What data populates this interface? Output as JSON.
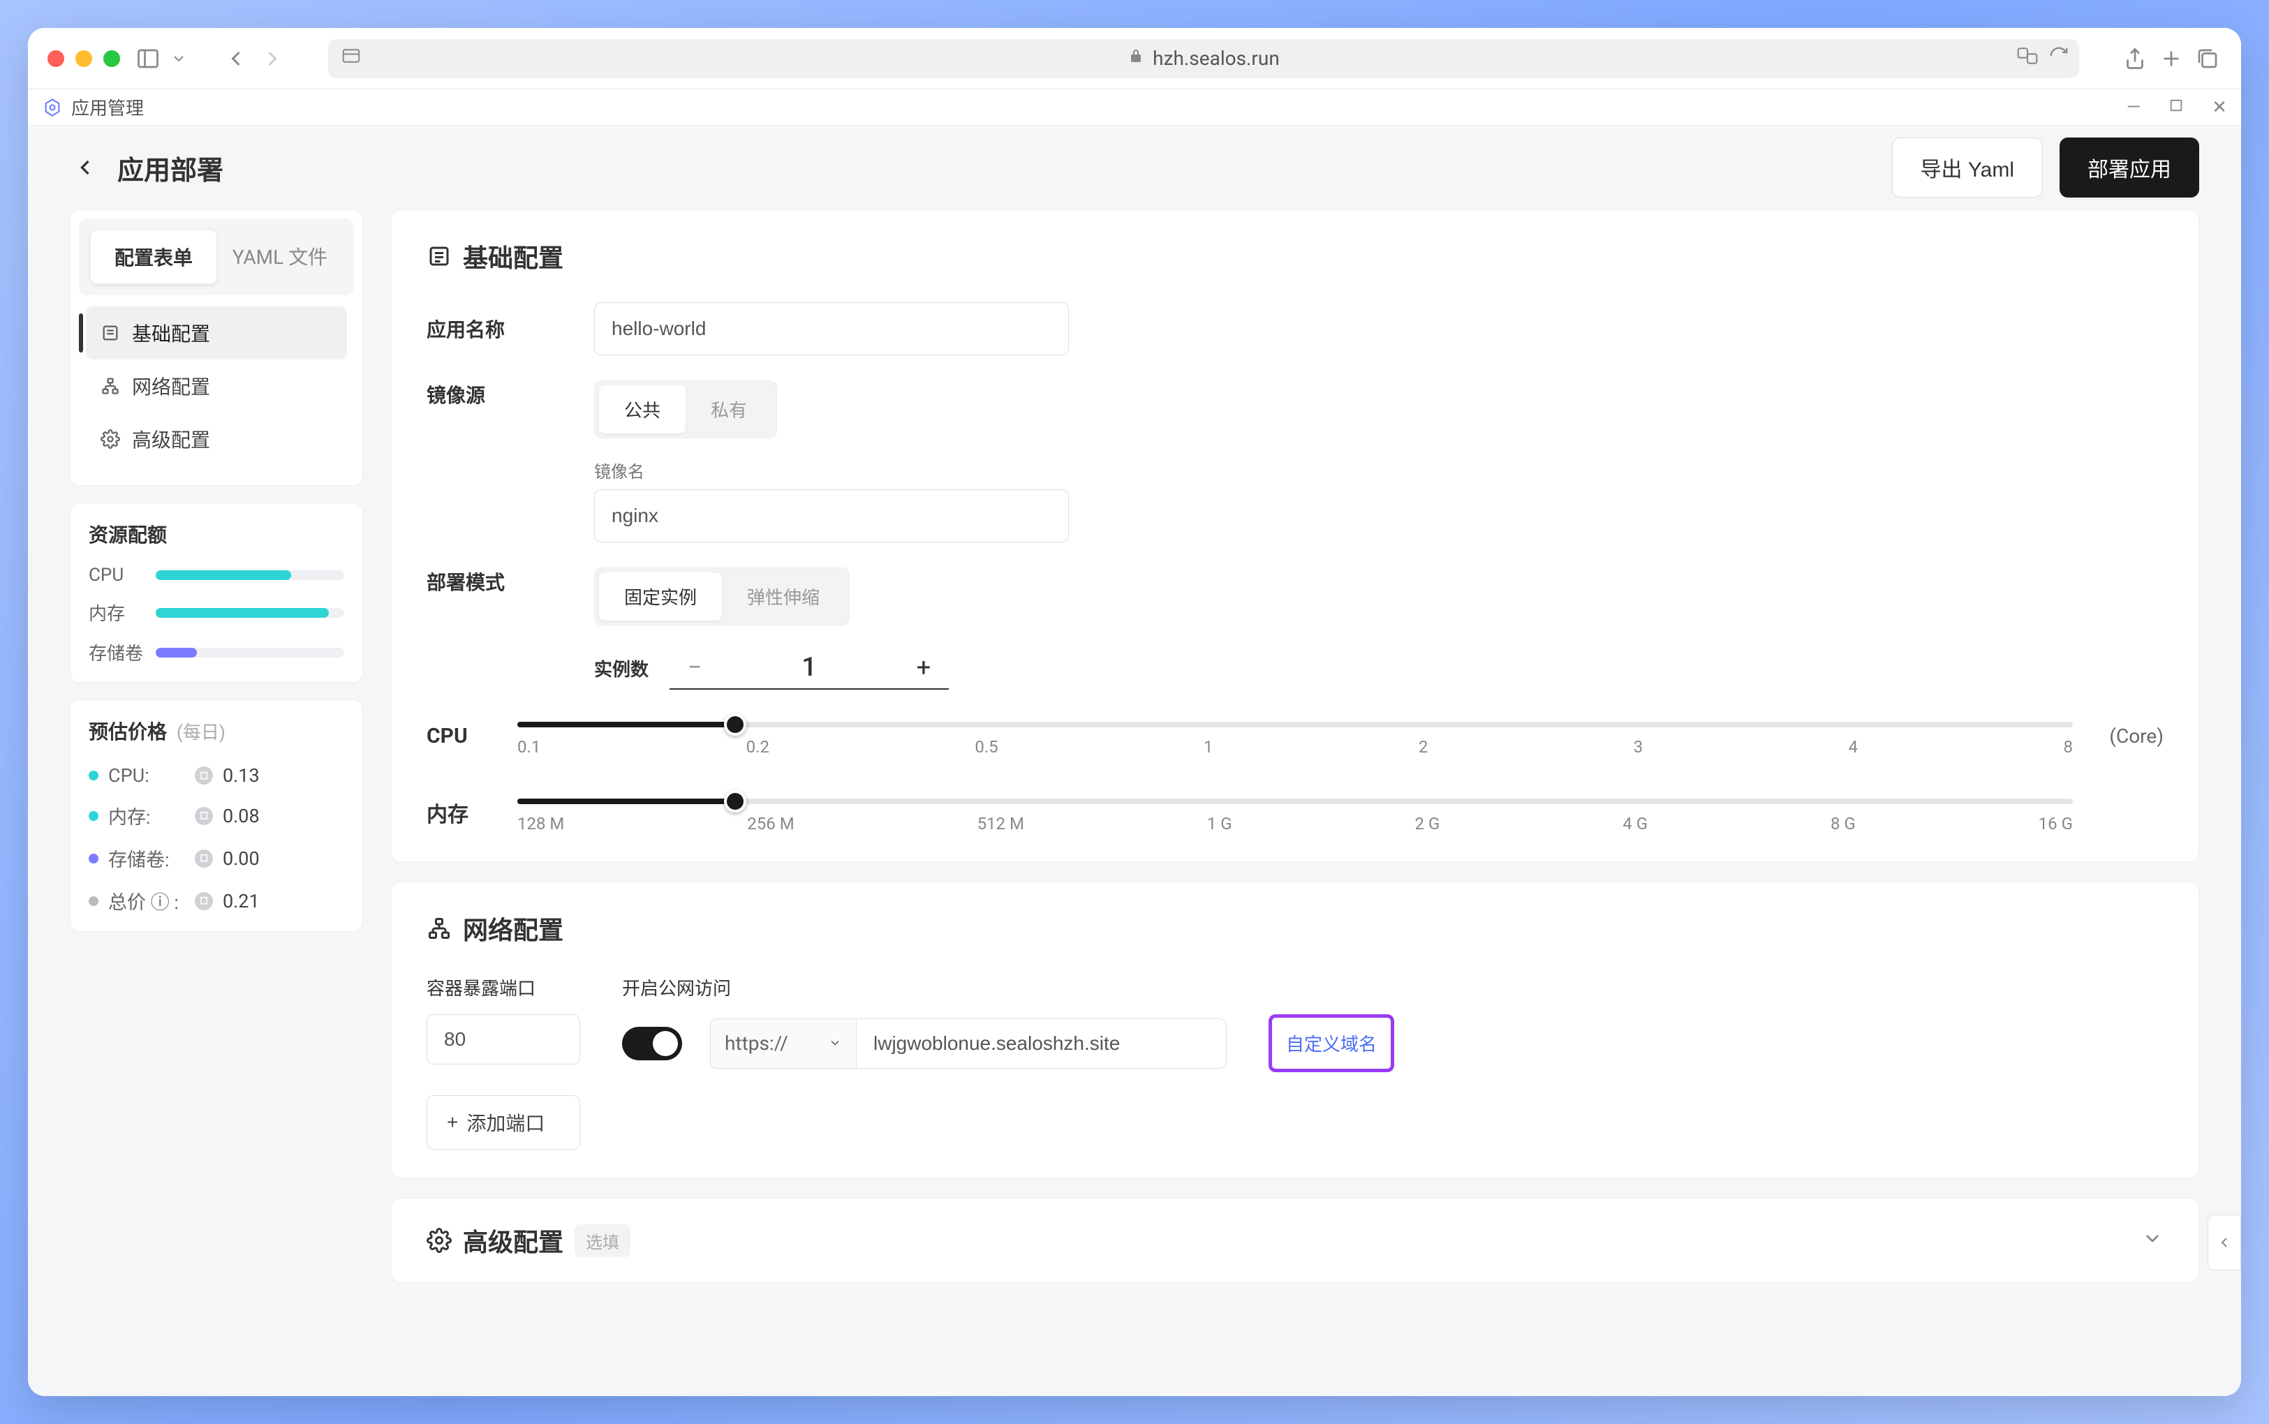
{
  "browser": {
    "url": "hzh.sealos.run"
  },
  "tab": {
    "title": "应用管理"
  },
  "header": {
    "title": "应用部署",
    "export_yaml": "导出 Yaml",
    "deploy": "部署应用"
  },
  "sidebar": {
    "tabs": {
      "config": "配置表单",
      "yaml": "YAML 文件"
    },
    "nav": {
      "basic": "基础配置",
      "network": "网络配置",
      "advanced": "高级配置"
    },
    "quota": {
      "title": "资源配额",
      "cpu": {
        "label": "CPU",
        "percent": 72
      },
      "mem": {
        "label": "内存",
        "percent": 92
      },
      "storage": {
        "label": "存储卷",
        "percent": 22
      }
    },
    "pricing": {
      "title": "预估价格",
      "period": "(每日)",
      "items": {
        "cpu": {
          "label": "CPU:",
          "value": "0.13"
        },
        "mem": {
          "label": "内存:",
          "value": "0.08"
        },
        "storage": {
          "label": "存储卷:",
          "value": "0.00"
        },
        "total": {
          "label": "总价 ⓘ :",
          "value": "0.21"
        }
      }
    }
  },
  "basic": {
    "title": "基础配置",
    "app_name": {
      "label": "应用名称",
      "value": "hello-world"
    },
    "image_source": {
      "label": "镜像源",
      "opts": {
        "public": "公共",
        "private": "私有"
      }
    },
    "image_name": {
      "label": "镜像名",
      "value": "nginx"
    },
    "deploy_mode": {
      "label": "部署模式",
      "opts": {
        "fixed": "固定实例",
        "elastic": "弹性伸缩"
      }
    },
    "instances": {
      "label": "实例数",
      "value": "1"
    },
    "cpu_slider": {
      "label": "CPU",
      "unit": "(Core)",
      "ticks": [
        "0.1",
        "0.2",
        "0.5",
        "1",
        "2",
        "3",
        "4",
        "8"
      ],
      "fill_percent": 14,
      "thumb_percent": 14
    },
    "mem_slider": {
      "label": "内存",
      "ticks": [
        "128 M",
        "256 M",
        "512 M",
        "1 G",
        "2 G",
        "4 G",
        "8 G",
        "16 G"
      ],
      "fill_percent": 14,
      "thumb_percent": 14
    }
  },
  "network": {
    "title": "网络配置",
    "port_label": "容器暴露端口",
    "port_value": "80",
    "public_label": "开启公网访问",
    "protocol": "https://",
    "domain": "lwjgwoblonue.sealoshzh.site",
    "custom_domain": "自定义域名",
    "add_port": "添加端口"
  },
  "advanced": {
    "title": "高级配置",
    "badge": "选填"
  }
}
